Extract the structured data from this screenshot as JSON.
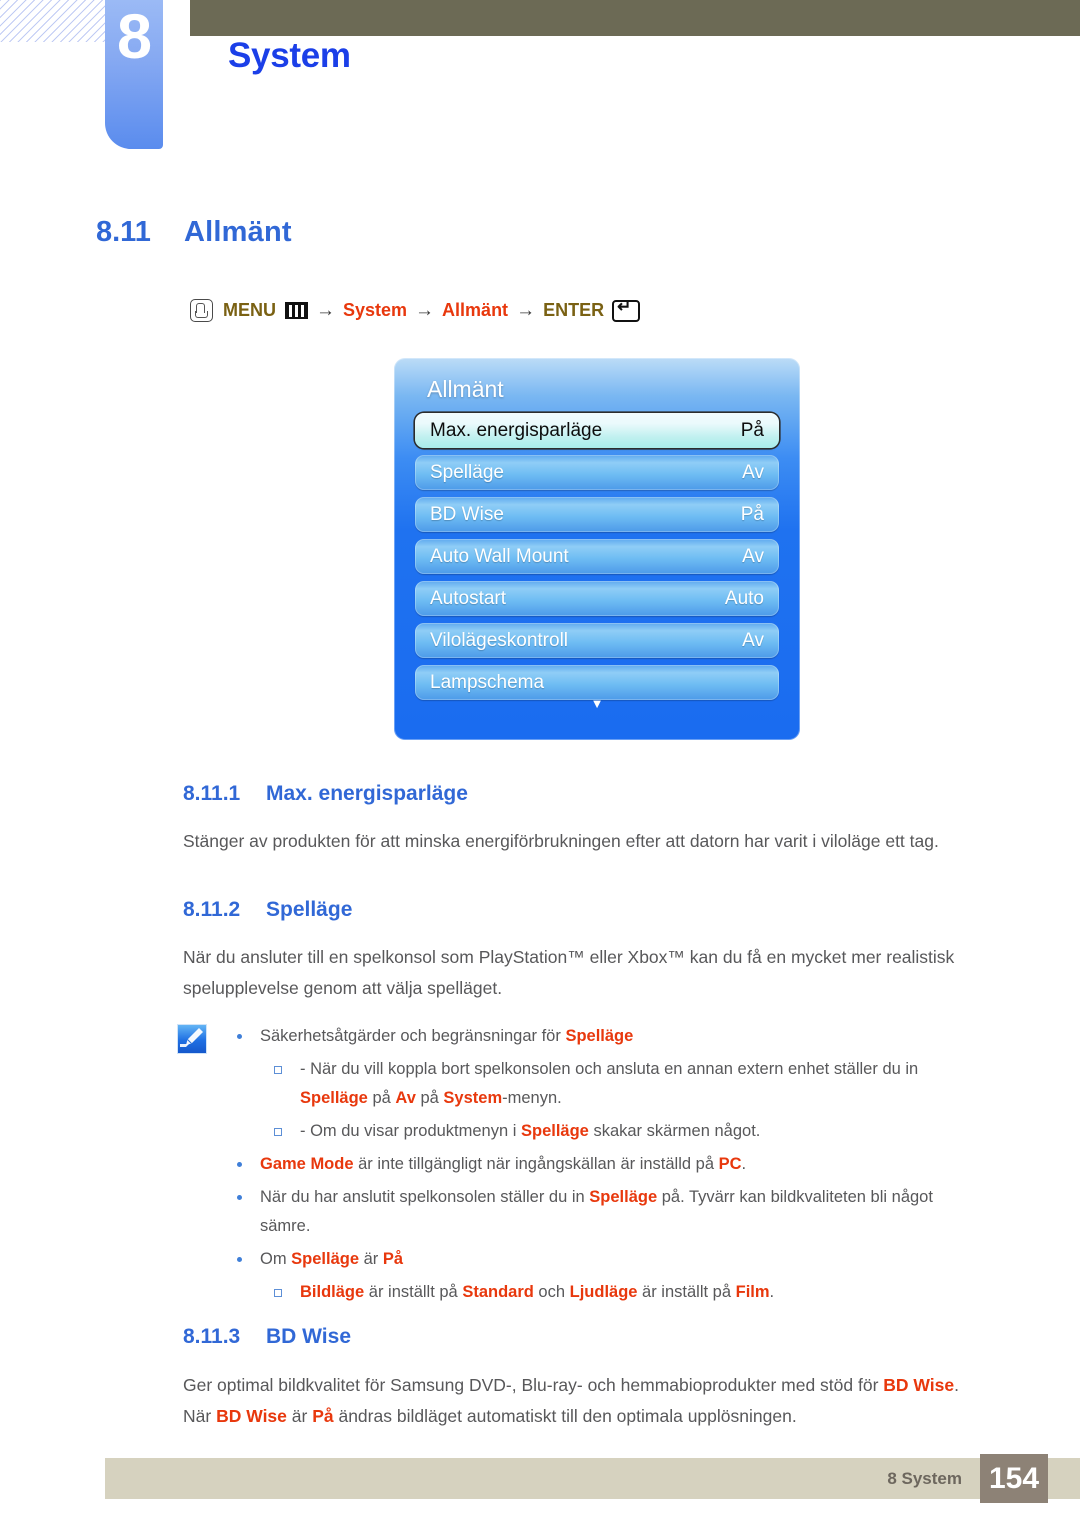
{
  "header": {
    "chapter_number": "8",
    "chapter_title": "System"
  },
  "section": {
    "number": "8.11",
    "title": "Allmänt"
  },
  "breadcrumb": {
    "hand_icon": "hand-press-icon",
    "menu_label": "MENU",
    "menu_icon": "menu-bars-icon",
    "arrow1": "→",
    "step1": "System",
    "arrow2": "→",
    "step2": "Allmänt",
    "arrow3": "→",
    "enter_label": "ENTER",
    "enter_icon": "enter-return-icon"
  },
  "osd": {
    "title": "Allmänt",
    "scroll_down_icon": "▼",
    "rows": [
      {
        "label": "Max. energisparläge",
        "value": "På",
        "selected": true
      },
      {
        "label": "Spelläge",
        "value": "Av",
        "selected": false
      },
      {
        "label": "BD Wise",
        "value": "På",
        "selected": false
      },
      {
        "label": "Auto Wall Mount",
        "value": "Av",
        "selected": false
      },
      {
        "label": "Autostart",
        "value": "Auto",
        "selected": false
      },
      {
        "label": "Vilolägeskontroll",
        "value": "Av",
        "selected": false
      },
      {
        "label": "Lampschema",
        "value": "",
        "selected": false
      }
    ]
  },
  "subsections": {
    "s1": {
      "number": "8.11.1",
      "title": "Max. energisparläge",
      "body": "Stänger av produkten för att minska energiförbrukningen efter att datorn har varit i viloläge ett tag."
    },
    "s2": {
      "number": "8.11.2",
      "title": "Spelläge",
      "body": "När du ansluter till en spelkonsol som PlayStation™ eller Xbox™ kan du få en mycket mer realistisk spelupplevelse genom att välja spelläget."
    },
    "s3": {
      "number": "8.11.3",
      "title": "BD Wise",
      "body_part1": "Ger optimal bildkvalitet för Samsung DVD-, Blu-ray- och hemmabioprodukter med stöd för ",
      "body_em1": "BD Wise",
      "body_part2": ". När ",
      "body_em2": "BD Wise",
      "body_part3": " är ",
      "body_em3": "På",
      "body_part4": " ändras bildläget automatiskt till den optimala upplösningen."
    }
  },
  "note": {
    "icon": "note-pencil-icon",
    "items": [
      {
        "level": 1,
        "segments": [
          {
            "t": "Säkerhetsåtgärder och begränsningar för ",
            "em": false
          },
          {
            "t": "Spelläge",
            "em": true
          }
        ]
      },
      {
        "level": 2,
        "segments": [
          {
            "t": "- När du vill koppla bort spelkonsolen och ansluta en annan extern enhet ställer du in ",
            "em": false
          },
          {
            "t": "Spelläge",
            "em": true
          },
          {
            "t": " på ",
            "em": false
          },
          {
            "t": "Av",
            "em": true
          },
          {
            "t": " på ",
            "em": false
          },
          {
            "t": "System",
            "em": true
          },
          {
            "t": "-menyn.",
            "em": false
          }
        ]
      },
      {
        "level": 2,
        "segments": [
          {
            "t": "- Om du visar produktmenyn i ",
            "em": false
          },
          {
            "t": "Spelläge",
            "em": true
          },
          {
            "t": " skakar skärmen något.",
            "em": false
          }
        ]
      },
      {
        "level": 1,
        "segments": [
          {
            "t": "Game Mode",
            "em": true
          },
          {
            "t": " är inte tillgängligt när ingångskällan är inställd på ",
            "em": false
          },
          {
            "t": "PC",
            "em": true
          },
          {
            "t": ".",
            "em": false
          }
        ]
      },
      {
        "level": 1,
        "segments": [
          {
            "t": "När du har anslutit spelkonsolen ställer du in ",
            "em": false
          },
          {
            "t": "Spelläge",
            "em": true
          },
          {
            "t": " på. Tyvärr kan bildkvaliteten bli något sämre.",
            "em": false
          }
        ]
      },
      {
        "level": 1,
        "segments": [
          {
            "t": "Om ",
            "em": false
          },
          {
            "t": "Spelläge",
            "em": true
          },
          {
            "t": " är ",
            "em": false
          },
          {
            "t": "På",
            "em": true
          }
        ]
      },
      {
        "level": 2,
        "segments": [
          {
            "t": "Bildläge",
            "em": true
          },
          {
            "t": " är inställt på ",
            "em": false
          },
          {
            "t": "Standard",
            "em": true
          },
          {
            "t": " och ",
            "em": false
          },
          {
            "t": "Ljudläge",
            "em": true
          },
          {
            "t": " är inställt på ",
            "em": false
          },
          {
            "t": "Film",
            "em": true
          },
          {
            "t": ".",
            "em": false
          }
        ]
      }
    ]
  },
  "footer": {
    "label": "8 System",
    "page": "154"
  },
  "colors": {
    "heading_blue": "#3168d6",
    "title_blue": "#1b3fe8",
    "accent_red": "#e8380d",
    "crumb_gold": "#7a6113",
    "olive": "#6c6a55",
    "footer_bar": "#d6d2bf",
    "footer_page_box": "#8d8276",
    "osd_blue": "#1a6cf0"
  }
}
